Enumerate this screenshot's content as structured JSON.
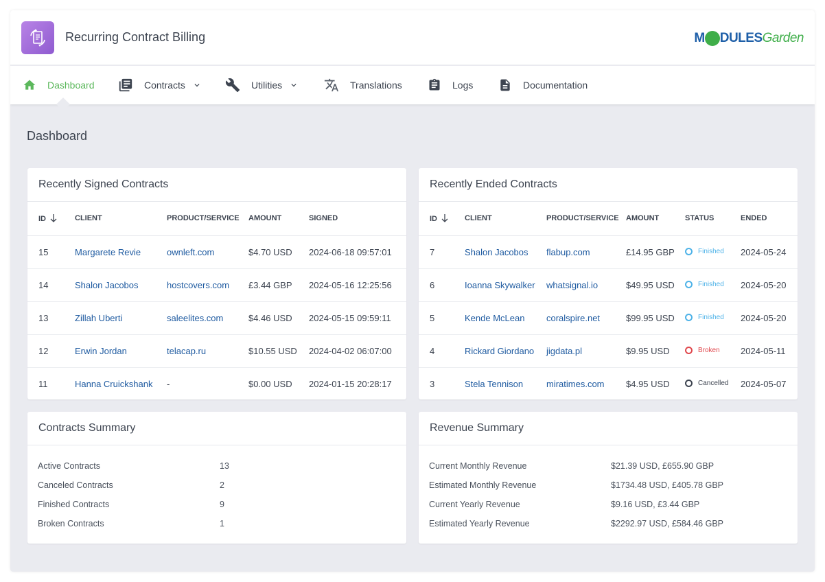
{
  "app": {
    "title": "Recurring Contract Billing"
  },
  "brand": {
    "m": "M",
    "dules": "DULES",
    "garden": "Garden"
  },
  "nav": {
    "dashboard": "Dashboard",
    "contracts": "Contracts",
    "utilities": "Utilities",
    "translations": "Translations",
    "logs": "Logs",
    "documentation": "Documentation"
  },
  "page": {
    "title": "Dashboard"
  },
  "signed": {
    "title": "Recently Signed Contracts",
    "headers": {
      "id": "ID",
      "client": "CLIENT",
      "product": "PRODUCT/SERVICE",
      "amount": "AMOUNT",
      "date": "SIGNED"
    },
    "rows": [
      {
        "id": "15",
        "client": "Margarete Revie",
        "product": "ownleft.com",
        "amount": "$4.70 USD",
        "date": "2024-06-18 09:57:01"
      },
      {
        "id": "14",
        "client": "Shalon Jacobos",
        "product": "hostcovers.com",
        "amount": "£3.44 GBP",
        "date": "2024-05-16 12:25:56"
      },
      {
        "id": "13",
        "client": "Zillah Uberti",
        "product": "saleelites.com",
        "amount": "$4.46 USD",
        "date": "2024-05-15 09:59:11"
      },
      {
        "id": "12",
        "client": "Erwin Jordan",
        "product": "telacap.ru",
        "amount": "$10.55 USD",
        "date": "2024-04-02 06:07:00"
      },
      {
        "id": "11",
        "client": "Hanna Cruickshank",
        "product": "-",
        "amount": "$0.00 USD",
        "date": "2024-01-15 20:28:17"
      }
    ]
  },
  "ended": {
    "title": "Recently Ended Contracts",
    "headers": {
      "id": "ID",
      "client": "CLIENT",
      "product": "PRODUCT/SERVICE",
      "amount": "AMOUNT",
      "status": "STATUS",
      "date": "ENDED"
    },
    "rows": [
      {
        "id": "7",
        "client": "Shalon Jacobos",
        "product": "flabup.com",
        "amount": "£14.95 GBP",
        "status": "Finished",
        "date": "2024-05-24"
      },
      {
        "id": "6",
        "client": "Ioanna Skywalker",
        "product": "whatsignal.io",
        "amount": "$49.95 USD",
        "status": "Finished",
        "date": "2024-05-20"
      },
      {
        "id": "5",
        "client": "Kende McLean",
        "product": "coralspire.net",
        "amount": "$99.95 USD",
        "status": "Finished",
        "date": "2024-05-20"
      },
      {
        "id": "4",
        "client": "Rickard Giordano",
        "product": "jigdata.pl",
        "amount": "$9.95 USD",
        "status": "Broken",
        "date": "2024-05-11"
      },
      {
        "id": "3",
        "client": "Stela Tennison",
        "product": "miratimes.com",
        "amount": "$4.95 USD",
        "status": "Cancelled",
        "date": "2024-05-07"
      }
    ]
  },
  "status_colors": {
    "Finished": "#4fb3e8",
    "Broken": "#e0474c",
    "Cancelled": "#3d4450"
  },
  "contracts_summary": {
    "title": "Contracts Summary",
    "rows": [
      {
        "label": "Active Contracts",
        "value": "13"
      },
      {
        "label": "Canceled Contracts",
        "value": "2"
      },
      {
        "label": "Finished Contracts",
        "value": "9"
      },
      {
        "label": "Broken Contracts",
        "value": "1"
      }
    ]
  },
  "revenue_summary": {
    "title": "Revenue Summary",
    "rows": [
      {
        "label": "Current Monthly Revenue",
        "value": "$21.39 USD, £655.90 GBP"
      },
      {
        "label": "Estimated Monthly Revenue",
        "value": "$1734.48 USD, £405.78 GBP"
      },
      {
        "label": "Current Yearly Revenue",
        "value": "$9.16 USD, £3.44 GBP"
      },
      {
        "label": "Estimated Yearly Revenue",
        "value": "$2292.97 USD, £584.46 GBP"
      }
    ]
  },
  "icons": [
    "app-icon",
    "home-icon",
    "contracts-icon",
    "wrench-icon",
    "translate-icon",
    "clipboard-icon",
    "document-icon",
    "chevron-down-icon",
    "sort-arrow-icon"
  ],
  "colors": {
    "accent": "#5cb85c",
    "link": "#1e5aa0",
    "background": "#eaebf0"
  }
}
